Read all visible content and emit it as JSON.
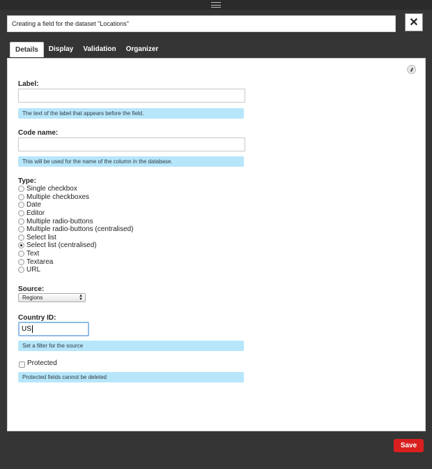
{
  "dialog": {
    "title": "Creating a field for the dataset \"Locations\"",
    "close_icon": "close-icon",
    "tabs": [
      {
        "label": "Details",
        "active": true
      },
      {
        "label": "Display",
        "active": false
      },
      {
        "label": "Validation",
        "active": false
      },
      {
        "label": "Organizer",
        "active": false
      }
    ]
  },
  "form": {
    "label": {
      "label": "Label:",
      "value": "",
      "hint": "The text of the label that appears before the field."
    },
    "code_name": {
      "label": "Code name:",
      "value": "",
      "hint": "This will be used for the name of the column in the database."
    },
    "type": {
      "label": "Type:",
      "options": [
        "Single checkbox",
        "Multiple checkboxes",
        "Date",
        "Editor",
        "Multiple radio-buttons",
        "Multiple radio-buttons (centralised)",
        "Select list",
        "Select list (centralised)",
        "Text",
        "Textarea",
        "URL"
      ],
      "selected": "Select list (centralised)"
    },
    "source": {
      "label": "Source:",
      "selected": "Regions"
    },
    "country_id": {
      "label": "Country ID:",
      "value": "US",
      "hint": "Set a filter for the source"
    },
    "protected": {
      "label": "Protected",
      "checked": false,
      "hint": "Protected fields cannot be deleted"
    }
  },
  "footer": {
    "save_label": "Save"
  },
  "colors": {
    "save": "#d9201f",
    "hint_bg": "#b7e6fb",
    "focus": "#8fbce8"
  }
}
